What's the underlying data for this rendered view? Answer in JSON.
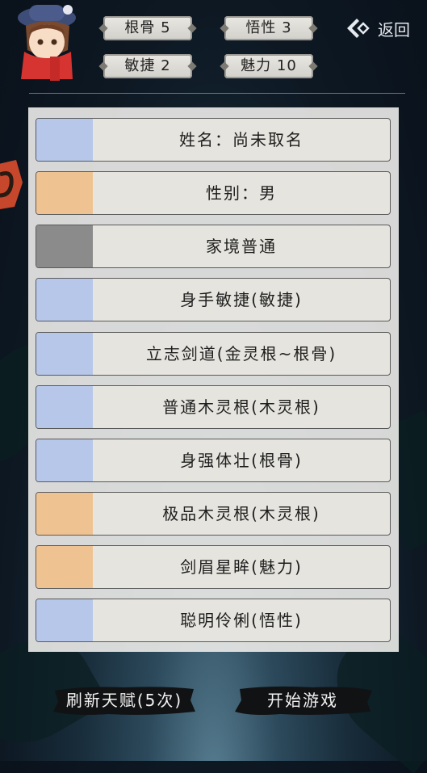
{
  "stats": {
    "root_bone": "根骨 5",
    "comprehension": "悟性 3",
    "agility": "敏捷 2",
    "charm": "魅力 10"
  },
  "header": {
    "back_label": "返回"
  },
  "talents": [
    {
      "label": "姓名：尚未取名",
      "color": "#b6c7e9"
    },
    {
      "label": "性别：男",
      "color": "#efc391"
    },
    {
      "label": "家境普通",
      "color": "#8b8b8b"
    },
    {
      "label": "身手敏捷(敏捷)",
      "color": "#b6c7e9"
    },
    {
      "label": "立志剑道(金灵根~根骨)",
      "color": "#b6c7e9"
    },
    {
      "label": "普通木灵根(木灵根)",
      "color": "#b6c7e9"
    },
    {
      "label": "身强体壮(根骨)",
      "color": "#b6c7e9"
    },
    {
      "label": "极品木灵根(木灵根)",
      "color": "#efc391"
    },
    {
      "label": "剑眉星眸(魅力)",
      "color": "#efc391"
    },
    {
      "label": "聪明伶俐(悟性)",
      "color": "#b6c7e9"
    }
  ],
  "actions": {
    "refresh_label": "刷新天赋(5次)",
    "start_label": "开始游戏"
  }
}
